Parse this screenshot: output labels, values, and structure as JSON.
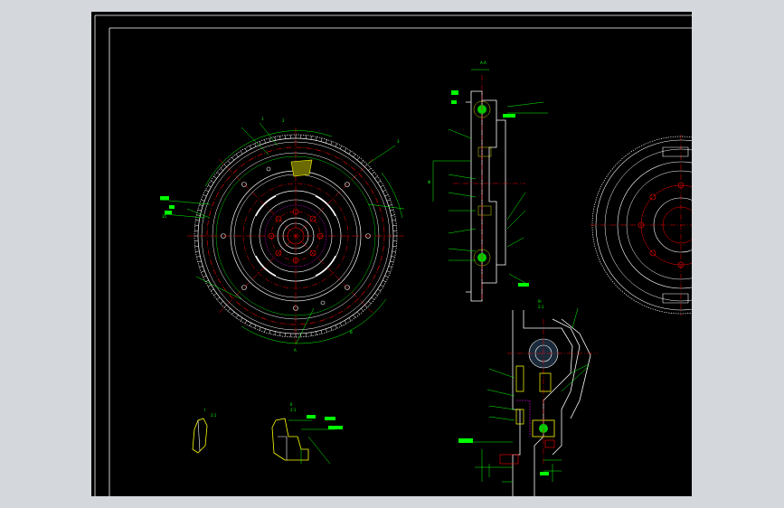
{
  "app": {
    "background_color": "#d4d7dc"
  },
  "drawing": {
    "background_color": "#000000",
    "colors": {
      "frame": "#ffffff",
      "outline": "#ffffff",
      "dimension": "#00ff00",
      "centerline": "#ff0000",
      "hidden": "#ff00ff",
      "leader_text": "#00ff00",
      "label_fill": "#00ff00"
    },
    "views": [
      {
        "id": "front-view",
        "description_icon": "flywheel-front-icon"
      },
      {
        "id": "section-view",
        "description_icon": "flywheel-section-icon"
      },
      {
        "id": "partial-front-view",
        "description_icon": "flywheel-partial-icon"
      },
      {
        "id": "detail-i",
        "description_icon": "detail-view-icon"
      },
      {
        "id": "detail-ii",
        "description_icon": "detail-view-icon"
      },
      {
        "id": "enlarged-section",
        "description_icon": "enlarged-section-icon"
      }
    ]
  }
}
